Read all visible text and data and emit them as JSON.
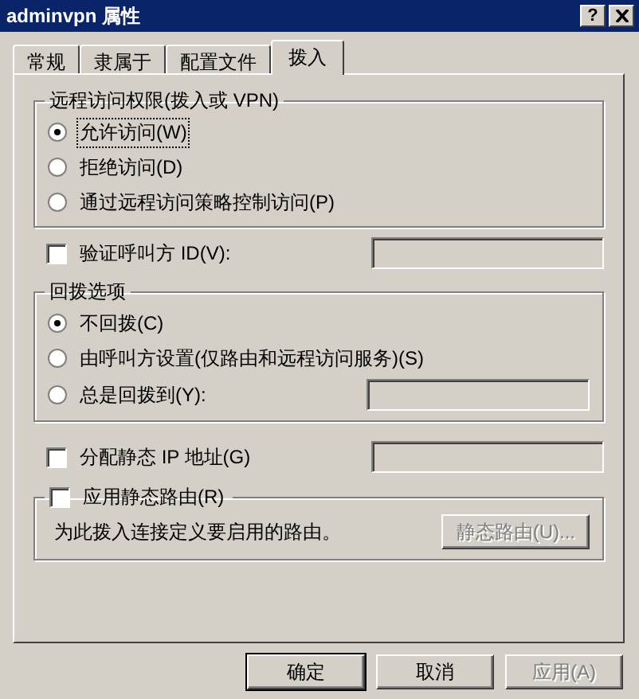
{
  "window": {
    "title": "adminvpn 属性",
    "help": "?"
  },
  "tabs": [
    {
      "label": "常规",
      "selected": false
    },
    {
      "label": "隶属于",
      "selected": false
    },
    {
      "label": "配置文件",
      "selected": false
    },
    {
      "label": "拨入",
      "selected": true
    }
  ],
  "access_group": {
    "title": "远程访问权限(拨入或 VPN)",
    "options": [
      {
        "label": "允许访问(W)",
        "selected": true,
        "focused": true
      },
      {
        "label": "拒绝访问(D)",
        "selected": false,
        "focused": false
      },
      {
        "label": "通过远程访问策略控制访问(P)",
        "selected": false,
        "focused": false
      }
    ]
  },
  "verify_caller_id": {
    "label": "验证呼叫方 ID(V):",
    "checked": false,
    "field_disabled": true
  },
  "callback_group": {
    "title": "回拨选项",
    "options": [
      {
        "label": "不回拨(C)",
        "selected": true
      },
      {
        "label": "由呼叫方设置(仅路由和远程访问服务)(S)",
        "selected": false
      },
      {
        "label": "总是回拨到(Y):",
        "selected": false,
        "field_disabled": true
      }
    ]
  },
  "static_ip": {
    "label": "分配静态 IP 地址(G)",
    "checked": false,
    "field_disabled": true
  },
  "static_routes": {
    "label": "应用静态路由(R)",
    "checked": false,
    "description": "为此拨入连接定义要启用的路由。",
    "button": {
      "label": "静态路由(U)...",
      "disabled": true
    }
  },
  "buttons": [
    {
      "label": "确定",
      "disabled": false,
      "default": true
    },
    {
      "label": "取消",
      "disabled": false,
      "default": false
    },
    {
      "label": "应用(A)",
      "disabled": true,
      "default": false
    }
  ]
}
